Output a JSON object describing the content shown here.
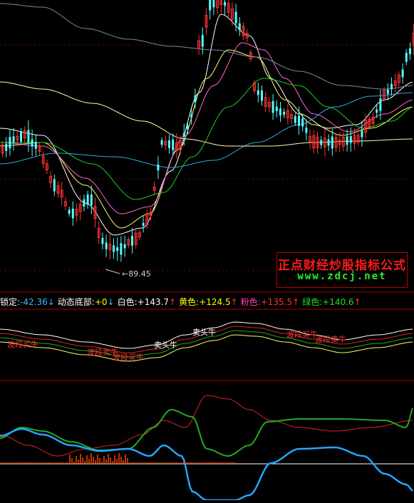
{
  "chart_data": {
    "type": "candlestick",
    "panels": [
      "price-main",
      "signal-band",
      "oscillator"
    ],
    "price_low_label": "89.45",
    "indicator_header": [
      {
        "text": "锁定:",
        "color": "#ffffff"
      },
      {
        "text": "-42.36",
        "color": "#3db8ff"
      },
      {
        "text": "↓",
        "color": "#3db8ff"
      },
      {
        "text": "动态底部:",
        "color": "#ffffff"
      },
      {
        "text": "+0",
        "color": "#ffff00"
      },
      {
        "text": "↓",
        "color": "#3db8ff"
      },
      {
        "text": "白色:",
        "color": "#ffffff"
      },
      {
        "text": "+143.7",
        "color": "#ffffff"
      },
      {
        "text": "↑",
        "color": "#ff3333"
      },
      {
        "text": "黄色:",
        "color": "#ffff00"
      },
      {
        "text": "+124.5",
        "color": "#ffff00"
      },
      {
        "text": "↑",
        "color": "#ff3333"
      },
      {
        "text": "粉色:",
        "color": "#ff44aa"
      },
      {
        "text": "+135.5",
        "color": "#ff3333"
      },
      {
        "text": "↑",
        "color": "#ff3333"
      },
      {
        "text": "绿色:",
        "color": "#22dd22"
      },
      {
        "text": "+140.6",
        "color": "#22dd22"
      },
      {
        "text": "↑",
        "color": "#ff3333"
      }
    ],
    "signal_labels": [
      {
        "text": "波段买牛"
      },
      {
        "text": "波段卖牛"
      },
      {
        "text": "波段买牛"
      },
      {
        "text": "卖头牛"
      },
      {
        "text": "卖头牛"
      },
      {
        "text": "波段买牛"
      },
      {
        "text": "波段卖牛"
      }
    ],
    "colors": {
      "up": "#ff3333",
      "down": "#54ffff",
      "ma_white": "#ffffff",
      "ma_yellow": "#ffff66",
      "ma_pink": "#ff66cc",
      "ma_green": "#22cc22",
      "ma_cyan": "#33aadd",
      "ma_slow": "#ffffaa",
      "osc_blue": "#22a6ff",
      "osc_green": "#22aa22",
      "osc_red": "#dd2222"
    }
  },
  "watermark": {
    "line1": "正点财经炒股指标公式",
    "line2": "www.zdcj.net"
  }
}
